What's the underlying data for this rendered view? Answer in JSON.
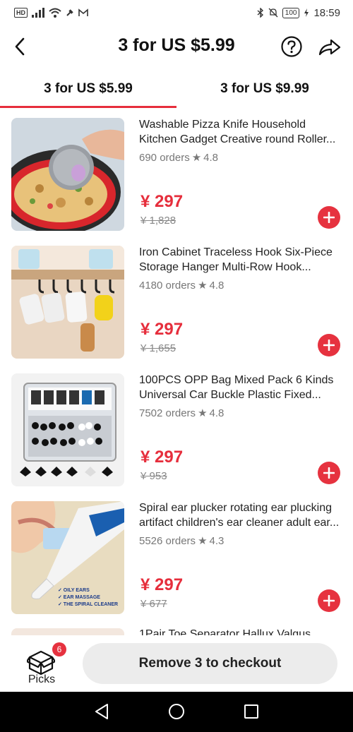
{
  "status_bar": {
    "left_icons": [
      "hd-icon",
      "signal-icon",
      "wifi-icon",
      "pin-icon",
      "gmail-icon"
    ],
    "battery": "100",
    "time": "18:59"
  },
  "header": {
    "title": "3 for US $5.99"
  },
  "tabs": [
    {
      "label": "3 for US $5.99",
      "active": true
    },
    {
      "label": "3 for US $9.99",
      "active": false
    }
  ],
  "products": [
    {
      "title": "Washable Pizza Knife Household Kitchen Gadget Creative round Roller...",
      "orders": "690 orders",
      "rating": "4.8",
      "price": "¥ 297",
      "old_price": "¥ 1,828"
    },
    {
      "title": "Iron Cabinet Traceless Hook Six-Piece Storage Hanger Multi-Row Hook...",
      "orders": "4180 orders",
      "rating": "4.8",
      "price": "¥ 297",
      "old_price": "¥ 1,655"
    },
    {
      "title": "100PCS OPP Bag Mixed Pack 6 Kinds Universal Car Buckle Plastic Fixed...",
      "orders": "7502 orders",
      "rating": "4.8",
      "price": "¥ 297",
      "old_price": "¥ 953"
    },
    {
      "title": "Spiral ear plucker rotating ear plucking artifact children's ear cleaner adult ear...",
      "orders": "5526 orders",
      "rating": "4.3",
      "price": "¥ 297",
      "old_price": "¥ 677"
    }
  ],
  "partial_product": {
    "title": "1Pair Toe Separator Hallux Valgus"
  },
  "bottom_bar": {
    "picks_label": "Picks",
    "picks_count": "6",
    "checkout_label": "Remove 3 to checkout"
  },
  "colors": {
    "accent": "#e62e3c",
    "text": "#222222",
    "muted": "#777777"
  }
}
